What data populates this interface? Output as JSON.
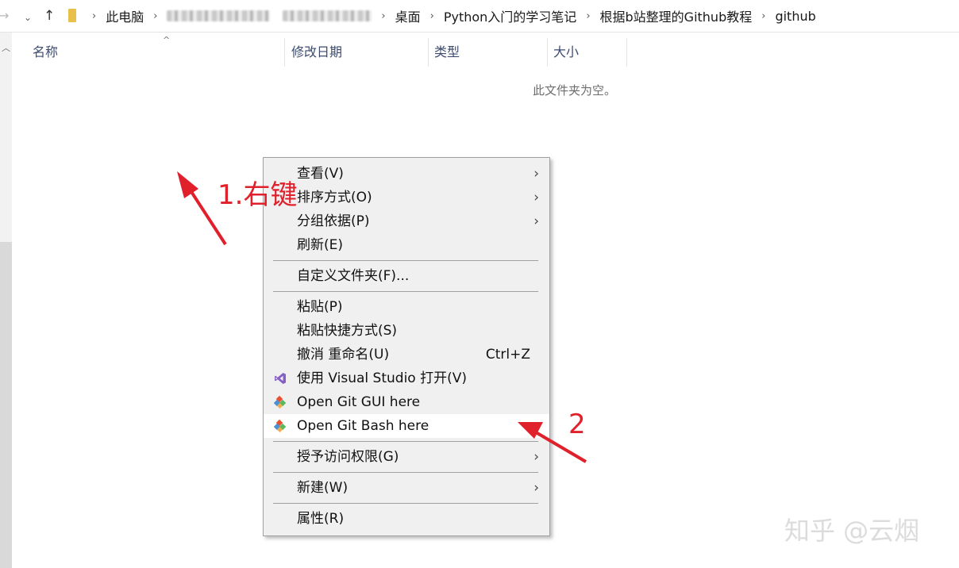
{
  "address_bar": {
    "breadcrumb": [
      "此电脑",
      "桌面",
      "Python入门的学习笔记",
      "根据b站整理的Github教程",
      "github"
    ]
  },
  "columns": {
    "name": "名称",
    "modified": "修改日期",
    "type": "类型",
    "size": "大小"
  },
  "empty_message": "此文件夹为空。",
  "context_menu": {
    "view": "查看(V)",
    "sort": "排序方式(O)",
    "group": "分组依据(P)",
    "refresh": "刷新(E)",
    "customize": "自定义文件夹(F)...",
    "paste": "粘贴(P)",
    "paste_shortcut": "粘贴快捷方式(S)",
    "undo": "撤消 重命名(U)",
    "undo_shortcut": "Ctrl+Z",
    "open_vs": "使用 Visual Studio 打开(V)",
    "git_gui": "Open Git GUI here",
    "git_bash": "Open Git Bash here",
    "grant_access": "授予访问权限(G)",
    "new": "新建(W)",
    "properties": "属性(R)"
  },
  "annotations": {
    "step1": "1.右键",
    "step2": "2"
  },
  "watermark": "知乎 @云烟",
  "colors": {
    "annotation_red": "#e0202a",
    "menu_bg": "#f0f0f0",
    "highlight_bg": "#ffffff",
    "vs_purple": "#865fc5"
  }
}
